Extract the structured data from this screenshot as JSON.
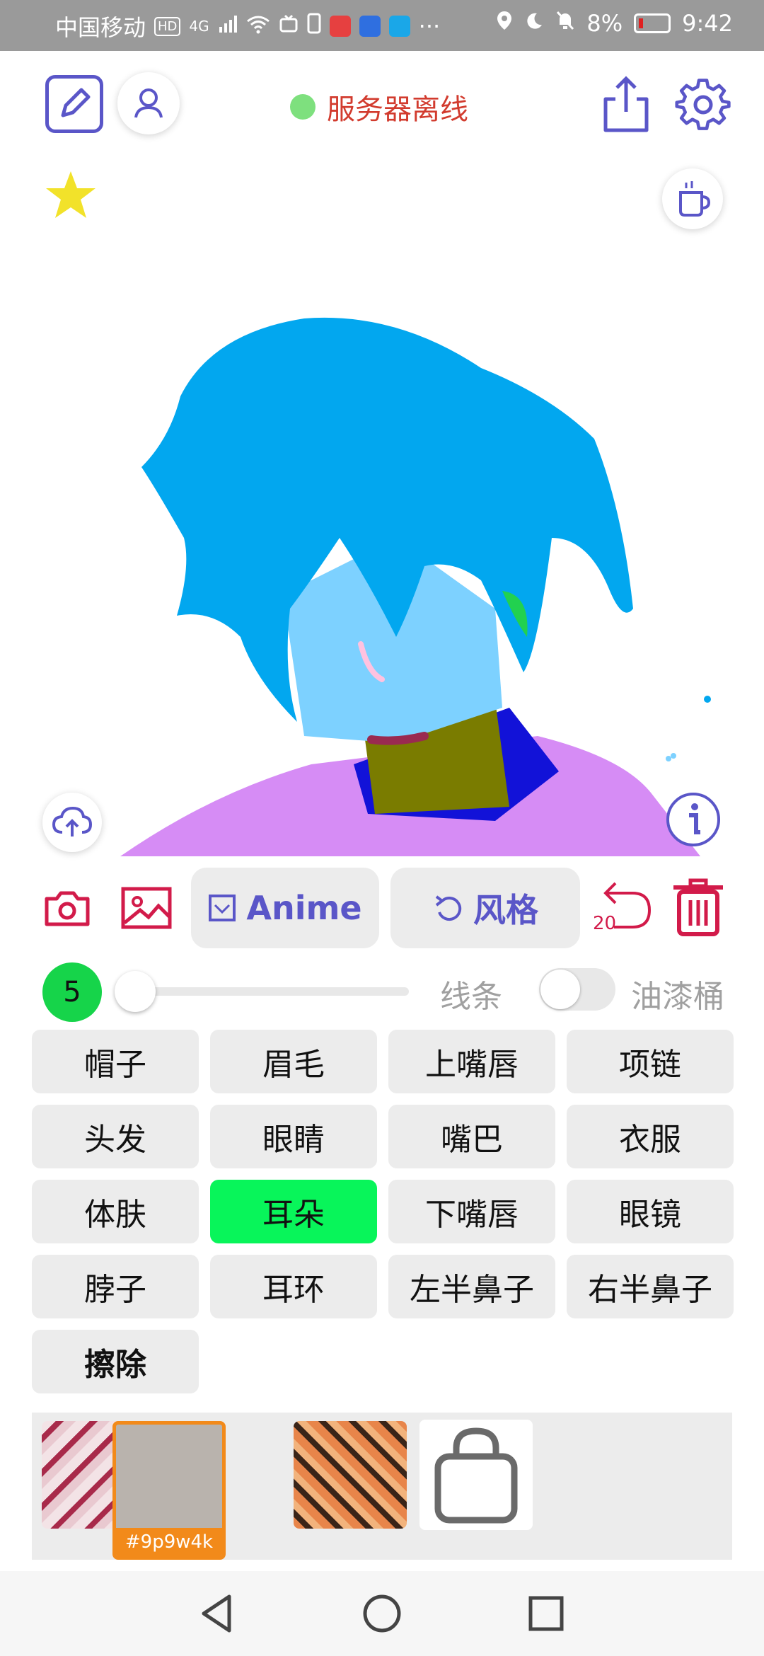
{
  "status_bar": {
    "carrier": "中国移动",
    "hd": "HD",
    "network": "4G",
    "more": "···",
    "battery": "8%",
    "time": "9:42"
  },
  "header": {
    "server_status": "服务器离线",
    "server_status_color": "#d23b2e",
    "status_dot_color": "#7ee07e"
  },
  "actions": {
    "anime_label": "Anime",
    "style_label": "风格",
    "undo_count": "20"
  },
  "brush": {
    "size": "5",
    "line_label": "线条",
    "bucket_label": "油漆桶"
  },
  "parts": [
    {
      "label": "帽子"
    },
    {
      "label": "眉毛"
    },
    {
      "label": "上嘴唇"
    },
    {
      "label": "项链"
    },
    {
      "label": "头发"
    },
    {
      "label": "眼睛"
    },
    {
      "label": "嘴巴"
    },
    {
      "label": "衣服"
    },
    {
      "label": "体肤"
    },
    {
      "label": "耳朵"
    },
    {
      "label": "下嘴唇"
    },
    {
      "label": "眼镜"
    },
    {
      "label": "脖子"
    },
    {
      "label": "耳环"
    },
    {
      "label": "左半鼻子"
    },
    {
      "label": "右半鼻子"
    },
    {
      "label": "擦除"
    }
  ],
  "selected_part": "耳朵",
  "styles": {
    "selected_id": "#9p9w4k"
  },
  "colors": {
    "accent": "#5a56c8",
    "danger": "#d21b4a",
    "active_part": "#08f55a",
    "size_badge": "#16d44a",
    "selected_style": "#f28a1a"
  }
}
